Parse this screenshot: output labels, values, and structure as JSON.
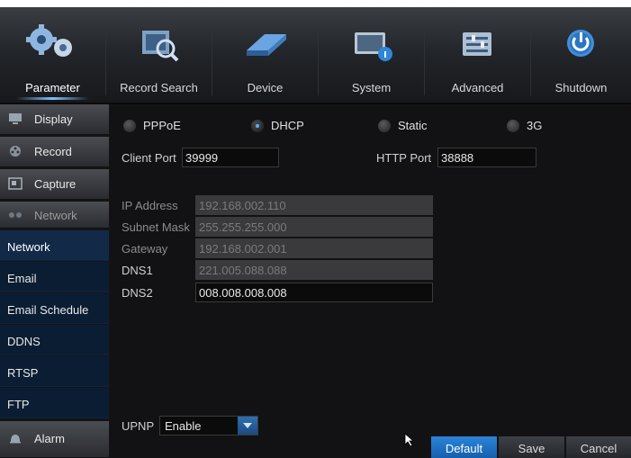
{
  "top_menu": [
    {
      "label": "Parameter",
      "icon": "gears-icon",
      "active": true
    },
    {
      "label": "Record Search",
      "icon": "record-search-icon"
    },
    {
      "label": "Device",
      "icon": "hard-drive-icon"
    },
    {
      "label": "System",
      "icon": "system-info-icon"
    },
    {
      "label": "Advanced",
      "icon": "advanced-settings-icon"
    },
    {
      "label": "Shutdown",
      "icon": "power-icon"
    }
  ],
  "sidebar": {
    "categories": {
      "display": "Display",
      "record": "Record",
      "capture": "Capture",
      "network": "Network",
      "alarm": "Alarm"
    },
    "network_items": [
      "Network",
      "Email",
      "Email Schedule",
      "DDNS",
      "RTSP",
      "FTP"
    ],
    "active_item": "Network"
  },
  "network_type": {
    "options": [
      "PPPoE",
      "DHCP",
      "Static",
      "3G"
    ],
    "selected": "DHCP"
  },
  "ports": {
    "client_port_label": "Client Port",
    "client_port_value": "39999",
    "http_port_label": "HTTP Port",
    "http_port_value": "38888"
  },
  "addresses": {
    "ip_label": "IP Address",
    "ip_value": "192.168.002.110",
    "mask_label": "Subnet Mask",
    "mask_value": "255.255.255.000",
    "gateway_label": "Gateway",
    "gateway_value": "192.168.002.001",
    "dns1_label": "DNS1",
    "dns1_value": "221.005.088.088",
    "dns2_label": "DNS2",
    "dns2_value": "008.008.008.008"
  },
  "upnp": {
    "label": "UPNP",
    "value": "Enable"
  },
  "buttons": {
    "default": "Default",
    "save": "Save",
    "cancel": "Cancel"
  },
  "colors": {
    "accent": "#1f73c6",
    "panel": "#121214",
    "sidebar_sub": "#0b1d33"
  }
}
